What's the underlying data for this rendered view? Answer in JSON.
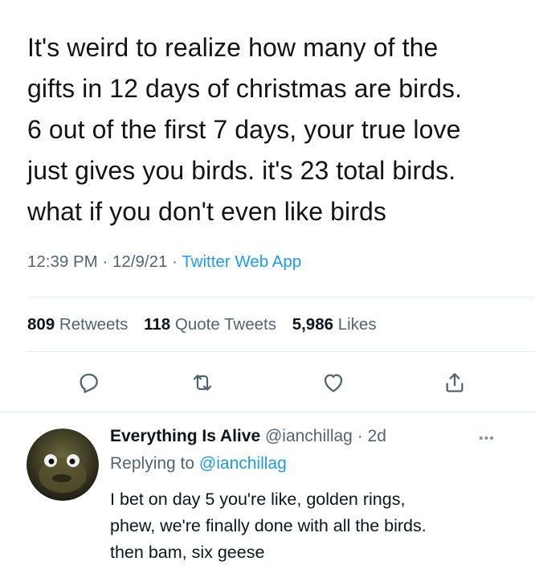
{
  "tweet": {
    "text_lines": [
      "It's weird to realize how many of the",
      "gifts in 12 days of christmas are birds.",
      "6 out of the first 7 days, your true love",
      "just gives you birds. it's 23 total birds.",
      "what if you don't even like birds"
    ],
    "time": "12:39 PM",
    "date": "12/9/21",
    "separator": "·",
    "source": "Twitter Web App"
  },
  "stats": {
    "retweets_count": "809",
    "retweets_label": "Retweets",
    "quotes_count": "118",
    "quotes_label": "Quote Tweets",
    "likes_count": "5,986",
    "likes_label": "Likes"
  },
  "actions": {
    "icons": [
      "reply-icon",
      "retweet-icon",
      "like-icon",
      "share-icon"
    ],
    "icon_color": "#536471"
  },
  "reply": {
    "author_name": "Everything Is Alive",
    "author_handle": "@ianchillag",
    "separator": "·",
    "age": "2d",
    "replying_prefix": "Replying to",
    "replying_to": "@ianchillag",
    "text_lines": [
      "I bet on day 5 you're like, golden rings,",
      "phew, we're finally done with all the birds.",
      "then bam, six geese"
    ],
    "more_icon": "ellipsis-icon"
  },
  "colors": {
    "link": "#1d9bf0",
    "secondary_text": "#536471",
    "divider": "#e6ecf0"
  }
}
